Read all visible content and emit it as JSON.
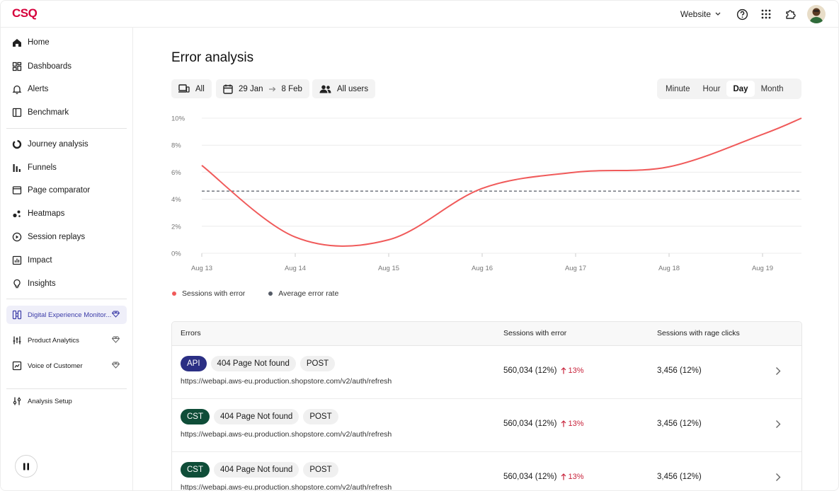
{
  "app": {
    "logo": "CSQ"
  },
  "topbar": {
    "site_selector": "Website",
    "icons": [
      "help-icon",
      "apps-grid-icon",
      "puzzle-icon",
      "avatar"
    ]
  },
  "sidebar": {
    "items": [
      {
        "label": "Home",
        "icon": "home-icon"
      },
      {
        "label": "Dashboards",
        "icon": "dashboard-icon"
      },
      {
        "label": "Alerts",
        "icon": "bell-icon"
      },
      {
        "label": "Benchmark",
        "icon": "benchmark-icon"
      },
      {
        "label": "Journey analysis",
        "icon": "journey-icon"
      },
      {
        "label": "Funnels",
        "icon": "funnel-icon"
      },
      {
        "label": "Page comparator",
        "icon": "page-comparator-icon"
      },
      {
        "label": "Heatmaps",
        "icon": "heatmap-icon"
      },
      {
        "label": "Session replays",
        "icon": "play-circle-icon"
      },
      {
        "label": "Impact",
        "icon": "impact-icon"
      },
      {
        "label": "Insights",
        "icon": "lightbulb-icon"
      }
    ],
    "products": [
      {
        "label": "Digital Experience Monitor...",
        "icon": "dem-icon",
        "active": true
      },
      {
        "label": "Product Analytics",
        "icon": "product-analytics-icon"
      },
      {
        "label": "Voice of Customer",
        "icon": "voc-icon"
      }
    ],
    "setup": {
      "label": "Analysis Setup",
      "icon": "sliders-icon"
    },
    "pause_icon": "pause-icon"
  },
  "main": {
    "title": "Error analysis",
    "filters": {
      "device": "All",
      "date_from": "29 Jan",
      "date_to": "8 Feb",
      "segment": "All users"
    },
    "granularity": {
      "options": [
        "Minute",
        "Hour",
        "Day",
        "Month"
      ],
      "selected": "Day"
    },
    "legend": [
      {
        "label": "Sessions with error",
        "color": "#f05a5a"
      },
      {
        "label": "Average error rate",
        "color": "#555b66"
      }
    ],
    "table": {
      "headers": [
        "Errors",
        "Sessions with error",
        "Sessions with rage clicks"
      ],
      "rows": [
        {
          "tag": "API",
          "tag_style": "api",
          "error": "404 Page Not found",
          "method": "POST",
          "url": "https://webapi.aws-eu.production.shopstore.com/v2/auth/refresh",
          "sessions": "560,034 (12%)",
          "change": "13%",
          "rage": "3,456 (12%)"
        },
        {
          "tag": "CST",
          "tag_style": "cst",
          "error": "404 Page Not found",
          "method": "POST",
          "url": "https://webapi.aws-eu.production.shopstore.com/v2/auth/refresh",
          "sessions": "560,034 (12%)",
          "change": "13%",
          "rage": "3,456 (12%)"
        },
        {
          "tag": "CST",
          "tag_style": "cst",
          "error": "404 Page Not found",
          "method": "POST",
          "url": "https://webapi.aws-eu.production.shopstore.com/v2/auth/refresh",
          "sessions": "560,034 (12%)",
          "change": "13%",
          "rage": "3,456 (12%)"
        }
      ]
    }
  },
  "chart_data": {
    "type": "line",
    "x": [
      "Aug 13",
      "Aug 14",
      "Aug 15",
      "Aug 16",
      "Aug 17",
      "Aug 18",
      "Aug 19"
    ],
    "y_ticks": [
      "0%",
      "2%",
      "4%",
      "6%",
      "8%",
      "10%"
    ],
    "ylim": [
      0,
      10
    ],
    "series": [
      {
        "name": "Sessions with error",
        "color": "#f05a5a",
        "values": [
          6.5,
          1.2,
          1.0,
          4.8,
          6.0,
          6.4,
          8.8
        ],
        "end_value": 10.0
      }
    ],
    "reference_line": {
      "name": "Average error rate",
      "value": 4.6,
      "style": "dashed"
    },
    "grid": true
  }
}
